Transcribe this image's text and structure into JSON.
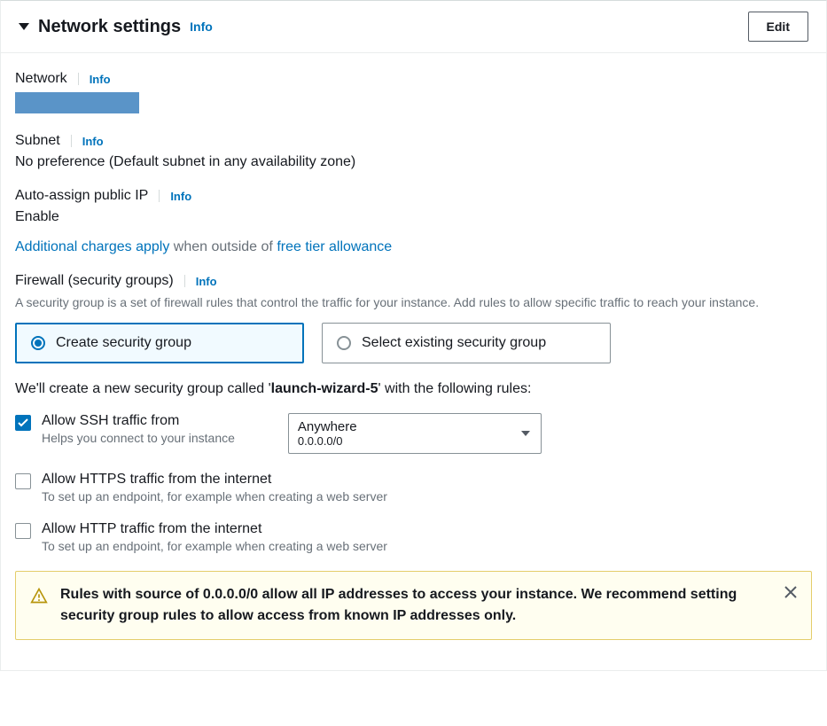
{
  "header": {
    "title": "Network settings",
    "info": "Info",
    "edit": "Edit"
  },
  "network": {
    "label": "Network",
    "info": "Info"
  },
  "subnet": {
    "label": "Subnet",
    "info": "Info",
    "value": "No preference (Default subnet in any availability zone)"
  },
  "autoAssign": {
    "label": "Auto-assign public IP",
    "info": "Info",
    "value": "Enable",
    "chargesLink": "Additional charges apply",
    "outsideText": " when outside of ",
    "freeTierLink": "free tier allowance"
  },
  "firewall": {
    "label": "Firewall (security groups)",
    "info": "Info",
    "desc": "A security group is a set of firewall rules that control the traffic for your instance. Add rules to allow specific traffic to reach your instance.",
    "createOption": "Create security group",
    "selectOption": "Select existing security group",
    "sgIntroPrefix": "We'll create a new security group called '",
    "sgName": "launch-wizard-5",
    "sgIntroSuffix": "' with the following rules:"
  },
  "rules": {
    "ssh": {
      "title": "Allow SSH traffic from",
      "desc": "Helps you connect to your instance",
      "selectMain": "Anywhere",
      "selectSub": "0.0.0.0/0"
    },
    "https": {
      "title": "Allow HTTPS traffic from the internet",
      "desc": "To set up an endpoint, for example when creating a web server"
    },
    "http": {
      "title": "Allow HTTP traffic from the internet",
      "desc": "To set up an endpoint, for example when creating a web server"
    }
  },
  "warning": {
    "text": "Rules with source of 0.0.0.0/0 allow all IP addresses to access your instance. We recommend setting security group rules to allow access from known IP addresses only."
  }
}
